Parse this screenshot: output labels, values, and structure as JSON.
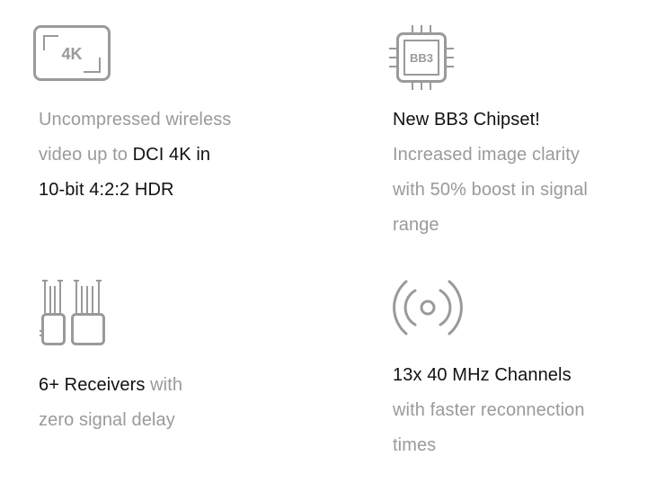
{
  "colors": {
    "icon_stroke": "#9a9a9a",
    "highlight_text": "#111111",
    "muted_text": "#9a9a9a",
    "background": "#ffffff"
  },
  "features": [
    {
      "icon": "4k-display-icon",
      "icon_text": "4K",
      "lines": [
        [
          {
            "text": "Uncompressed wireless",
            "style": "muted"
          }
        ],
        [
          {
            "text": "video up to ",
            "style": "muted"
          },
          {
            "text": "DCI 4K in",
            "style": "highlight"
          }
        ],
        [
          {
            "text": "10-bit 4:2:2 HDR",
            "style": "highlight"
          }
        ]
      ]
    },
    {
      "icon": "chipset-icon",
      "icon_text": "BB3",
      "lines": [
        [
          {
            "text": "New BB3 Chipset!",
            "style": "highlight"
          }
        ],
        [
          {
            "text": "Increased image clarity",
            "style": "muted"
          }
        ],
        [
          {
            "text": "with 50% boost in signal",
            "style": "muted"
          }
        ],
        [
          {
            "text": "range",
            "style": "muted"
          }
        ]
      ]
    },
    {
      "icon": "receivers-icon",
      "lines": [
        [
          {
            "text": "6+ Receivers",
            "style": "highlight"
          },
          {
            "text": " with",
            "style": "muted"
          }
        ],
        [
          {
            "text": "zero signal delay",
            "style": "muted"
          }
        ]
      ]
    },
    {
      "icon": "wireless-signal-icon",
      "lines": [
        [
          {
            "text": "13x 40 MHz Channels",
            "style": "highlight"
          }
        ],
        [
          {
            "text": "with faster reconnection",
            "style": "muted"
          }
        ],
        [
          {
            "text": "times",
            "style": "muted"
          }
        ]
      ]
    }
  ]
}
